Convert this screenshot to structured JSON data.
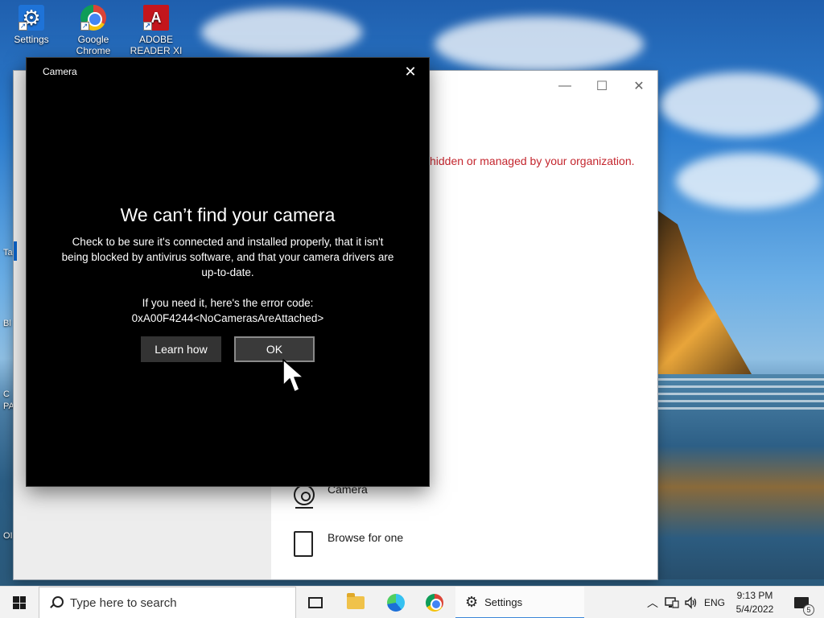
{
  "desktop": {
    "icons": [
      {
        "label": "Settings",
        "icon": "settings-icon"
      },
      {
        "label": "Google Chrome",
        "icon": "chrome-icon"
      },
      {
        "label": "ADOBE READER XI ...",
        "icon": "adobe-reader-icon"
      }
    ],
    "edge_labels": [
      "Ta",
      "Bl",
      "C",
      "PA",
      "OI"
    ]
  },
  "settings_window": {
    "message": "hidden or managed by your organization.",
    "options": [
      {
        "label": "Camera",
        "icon": "camera-icon"
      },
      {
        "label": "Browse for one",
        "icon": "file-icon"
      }
    ],
    "controls": {
      "minimize": "—",
      "maximize": "☐",
      "close": "✕"
    }
  },
  "camera_dialog": {
    "title": "Camera",
    "close_glyph": "✕",
    "heading": "We can’t find your camera",
    "body": "Check to be sure it's connected and installed properly, that it isn't being blocked by antivirus software, and that your camera drivers are up-to-date.",
    "error_intro": "If you need it, here's the error code:",
    "error_code": "0xA00F4244<NoCamerasAreAttached>",
    "buttons": {
      "learn_how": "Learn how",
      "ok": "OK"
    }
  },
  "taskbar": {
    "search_placeholder": "Type here to search",
    "active_app": "Settings",
    "language": "ENG",
    "time": "9:13 PM",
    "date": "5/4/2022",
    "notification_count": "5"
  },
  "colors": {
    "dialog_bg": "#000000",
    "error_text": "#c4262e",
    "taskbar_bg": "#f2f2f2"
  }
}
